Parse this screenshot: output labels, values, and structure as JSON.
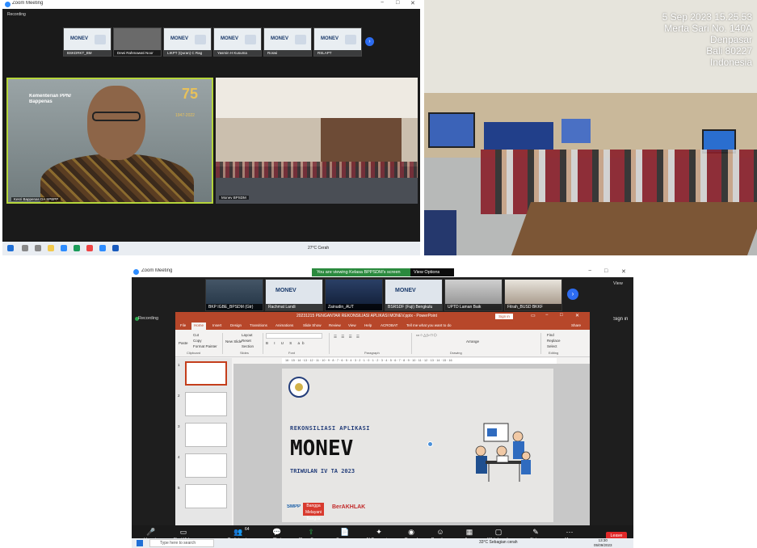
{
  "panel_a": {
    "window_title": "Zoom Meeting",
    "recording_label": "Recording",
    "thumbnails": [
      {
        "name": "BSKDRKT_BM"
      },
      {
        "name": "Dewi Rahmawati Noor"
      },
      {
        "name": "LIKPT (Quran) C Rag"
      },
      {
        "name": "Yasmin H Kusuma"
      },
      {
        "name": "Roswi"
      },
      {
        "name": "RSLAPT"
      }
    ],
    "monev_label": "MONEV",
    "speaker": {
      "name": "Kesri Bappenas DA SPBPP",
      "banner_line1": "Kementerian PPN/",
      "banner_line2": "Bappenas",
      "anniversary": "75",
      "anniversary_sub": "1947-2022"
    },
    "room_video_name": "Monev BPSDM",
    "taskbar": {
      "weather": "27°C Cerah"
    }
  },
  "panel_b": {
    "stamp_lines": [
      "5 Sep 2023 15.25.53",
      "Merta Sari No. 140A",
      "Denpasar",
      "Bali 80227",
      "Indonesia"
    ]
  },
  "panel_c": {
    "window_title": "Zoom Meeting",
    "viewing_banner": "You are viewing Kelasa BPPSDM's screen",
    "view_options": "View Options",
    "recording_label": "Recording",
    "view_label": "View",
    "sign_in": "Sign in",
    "thumbnails": [
      {
        "name": "BKP IGBE_BPSDM (Gtr)"
      },
      {
        "name": "Rachmat Landi"
      },
      {
        "name": "Zainudin_AUT"
      },
      {
        "name": "BSRSDF (Fuji) Bengkulu"
      },
      {
        "name": "UPTD Laman Baik"
      },
      {
        "name": "Fitrah_BUSD BKKF"
      }
    ],
    "monev_label": "MONEV",
    "ppt": {
      "title": "20231215 PENGANTAR REKONSILIASI APLIKASI MONEV.pptx - PowerPoint",
      "sign_in": "Sign in",
      "tabs": [
        "File",
        "Home",
        "Insert",
        "Design",
        "Transitions",
        "Animations",
        "Slide Show",
        "Review",
        "View",
        "Help",
        "ACROBAT",
        "Tell me what you want to do"
      ],
      "share": "Share",
      "ribbon": {
        "paste": "Paste",
        "cut": "Cut",
        "copy": "Copy",
        "format_painter": "Format Painter",
        "new_slide": "New Slide",
        "layout": "Layout",
        "reset": "Reset",
        "section": "Section",
        "arrange": "Arrange",
        "find": "Find",
        "replace": "Replace",
        "select": "Select",
        "groups": [
          "Clipboard",
          "Slides",
          "Font",
          "Paragraph",
          "Drawing",
          "Editing"
        ]
      },
      "ruler": "16 · 15 · 14 · 13 · 12 · 11 · 10 · 9 · 8 · 7 · 6 · 5 · 4 · 3 · 2 · 1 · 0 · 1 · 2 · 3 · 4 · 5 · 6 · 7 · 8 · 9 · 10 · 11 · 12 · 13 · 14 · 15 · 16",
      "slide_numbers": [
        "1",
        "2",
        "3",
        "4",
        "5"
      ],
      "slide": {
        "subtitle": "REKONSILIASI APLIKASI",
        "title": "MONEV",
        "period": "TRIWULAN IV TA 2023",
        "logo_a": "SMPP",
        "logo_b": "Bangga Melayani Bangsa",
        "logo_c": "BerAKHLAK"
      }
    },
    "toolbar": [
      {
        "icon": "mic-icon",
        "glyph": "🎤",
        "label": "Unmute"
      },
      {
        "icon": "video-icon",
        "glyph": "▭",
        "label": "Start Video"
      },
      {
        "icon": "participants-icon",
        "glyph": "👥",
        "label": "Participants"
      },
      {
        "icon": "chat-icon",
        "glyph": "💬",
        "label": "Chat"
      },
      {
        "icon": "share-screen-icon",
        "glyph": "⇪",
        "label": "Share Screen"
      },
      {
        "icon": "summary-icon",
        "glyph": "📄",
        "label": "Summary"
      },
      {
        "icon": "ai-companion-icon",
        "glyph": "✦",
        "label": "AI Companion"
      },
      {
        "icon": "record-icon",
        "glyph": "◉",
        "label": "Record"
      },
      {
        "icon": "reactions-icon",
        "glyph": "☺",
        "label": "Reactions"
      },
      {
        "icon": "apps-icon",
        "glyph": "▦",
        "label": "Apps"
      },
      {
        "icon": "whiteboards-icon",
        "glyph": "▢",
        "label": "Whiteboards"
      },
      {
        "icon": "notes-icon",
        "glyph": "✎",
        "label": "Notes"
      },
      {
        "icon": "more-icon",
        "glyph": "···",
        "label": "More"
      }
    ],
    "participants_count": "64",
    "leave_label": "Leave",
    "taskbar": {
      "search_placeholder": "Type here to search",
      "weather": "33°C Sebagian cerah",
      "time": "13:30",
      "date": "05/09/2023"
    }
  }
}
